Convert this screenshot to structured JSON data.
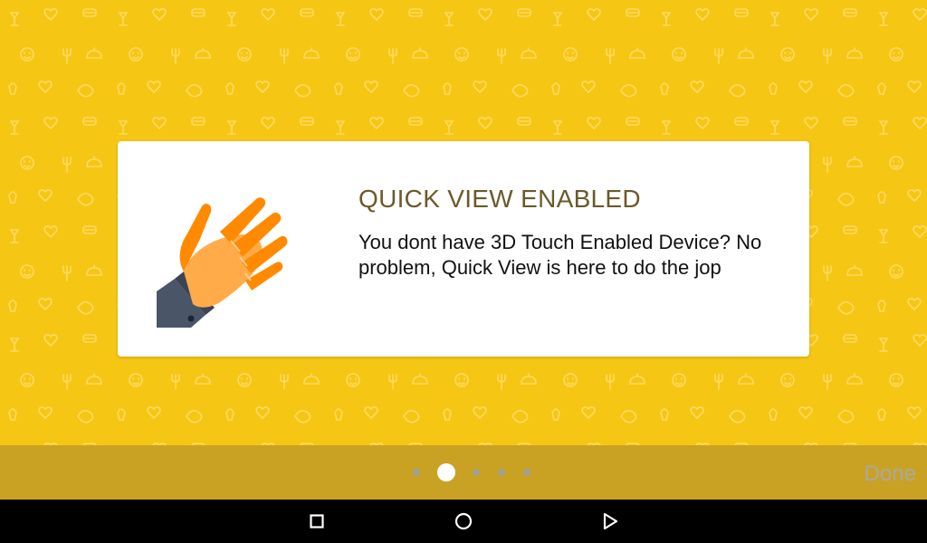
{
  "onboarding": {
    "title": "QUICK VIEW ENABLED",
    "body": "You dont have 3D Touch Enabled Device? No problem, Quick View is here to do the jop",
    "illustration_icon": "hand-icon"
  },
  "pager": {
    "page_count": 5,
    "active_index": 1,
    "done_label": "Done"
  },
  "system_nav": {
    "recent_icon": "square-icon",
    "home_icon": "circle-icon",
    "back_icon": "triangle-icon"
  },
  "colors": {
    "background": "#f6c615",
    "bottom_bar": "#c9a224",
    "title": "#6b5a2a",
    "hand_orange": "#ff8a00",
    "hand_light": "#ffab4a",
    "sleeve": "#4b5568"
  }
}
